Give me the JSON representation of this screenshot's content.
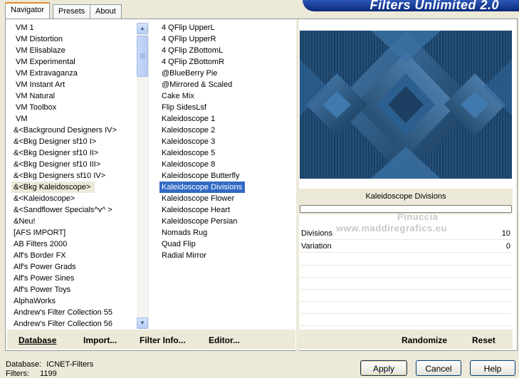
{
  "tabs": [
    {
      "label": "Navigator"
    },
    {
      "label": "Presets"
    },
    {
      "label": "About"
    }
  ],
  "brand": "Filters Unlimited 2.0",
  "categories": [
    "VM 1",
    "VM Distortion",
    "VM Elisablaze",
    "VM Experimental",
    "VM Extravaganza",
    "VM Instant Art",
    "VM Natural",
    "VM Toolbox",
    "VM",
    "&<Background Designers IV>",
    "&<Bkg Designer sf10 I>",
    "&<Bkg Designer sf10 II>",
    "&<Bkg Designer sf10 III>",
    "&<Bkg Designers sf10 IV>",
    "&<Bkg Kaleidoscope>",
    "&<Kaleidoscope>",
    "&<Sandflower Specials^v^ >",
    "&Neu!",
    "[AFS IMPORT]",
    "AB Filters 2000",
    "Alf's Border FX",
    "Alf's Power Grads",
    "Alf's Power Sines",
    "Alf's Power Toys",
    "AlphaWorks",
    "Andrew's Filter Collection 55",
    "Andrew's Filter Collection 56"
  ],
  "filters": [
    "4 QFlip UpperL",
    "4 QFlip UpperR",
    "4 QFlip ZBottomL",
    "4 QFlip ZBottomR",
    "@BlueBerry Pie",
    "@Mirrored & Scaled",
    "Cake Mix",
    "Flip SidesLsf",
    "Kaleidoscope 1",
    "Kaleidoscope 2",
    "Kaleidoscope 3",
    "Kaleidoscope 5",
    "Kaleidoscope 8",
    "Kaleidoscope Butterfly",
    "Kaleidoscope Divisions",
    "Kaleidoscope Flower",
    "Kaleidoscope Heart",
    "Kaleidoscope Persian",
    "Nomads Rug",
    "Quad Flip",
    "Radial Mirror"
  ],
  "selected_category": "&<Bkg Kaleidoscope>",
  "selected_filter": "Kaleidoscope Divisions",
  "current_filter_title": "Kaleidoscope Divisions",
  "watermark": {
    "line1": "Pinuccia",
    "line2": "www.maddiregrafics.eu"
  },
  "params": [
    {
      "name": "Divisions",
      "value": "10"
    },
    {
      "name": "Variation",
      "value": "0"
    }
  ],
  "links": {
    "database": "Database",
    "import": "Import...",
    "filter_info": "Filter Info...",
    "editor": "Editor...",
    "randomize": "Randomize",
    "reset": "Reset"
  },
  "status": {
    "database_label": "Database:",
    "database_value": "ICNET-Filters",
    "filters_label": "Filters:",
    "filters_value": "1199"
  },
  "buttons": {
    "apply": "Apply",
    "cancel": "Cancel",
    "help": "Help"
  },
  "colors": {
    "selection": "#316ac5",
    "tab_accent": "#e68b2c",
    "preview_bg": "#1e4468"
  }
}
